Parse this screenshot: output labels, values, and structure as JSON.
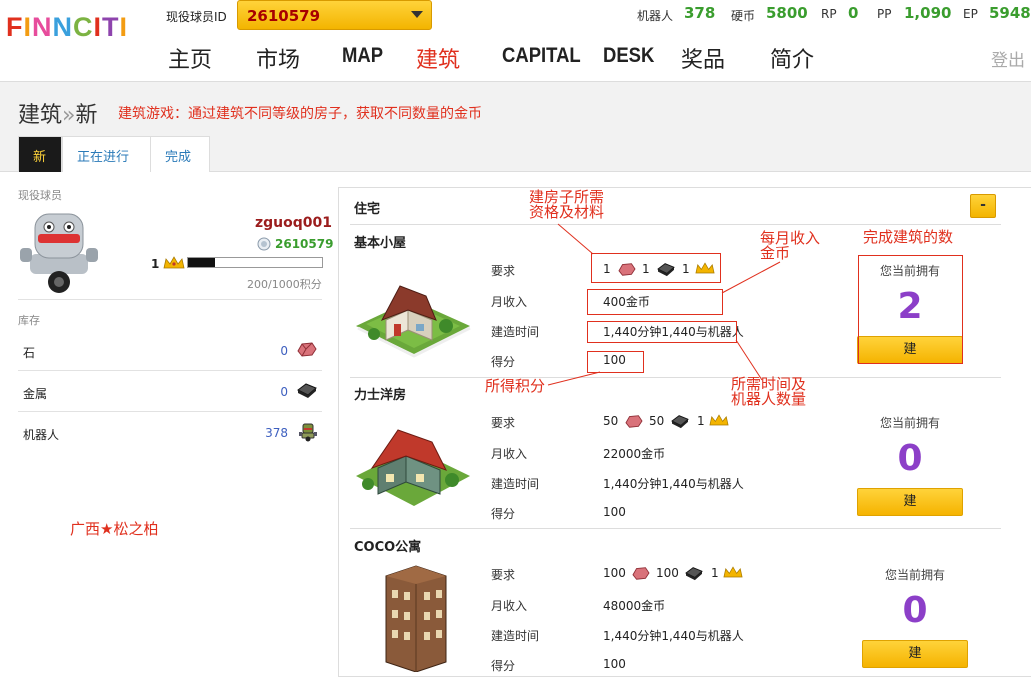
{
  "header": {
    "logo": "FINNCITI",
    "player_id_label": "现役球员ID",
    "player_id": "2610579",
    "stats": [
      {
        "label": "机器人",
        "value": "378"
      },
      {
        "label": "硬币",
        "value": "5800"
      },
      {
        "label": "RP",
        "value": "0"
      },
      {
        "label": "PP",
        "value": "1,090"
      },
      {
        "label": "EP",
        "value": "5948"
      }
    ],
    "nav": [
      "主页",
      "市场",
      "MAP",
      "建筑",
      "CAPITAL",
      "DESK",
      "奖品",
      "简介"
    ],
    "logout": "登出"
  },
  "page": {
    "title_a": "建筑",
    "title_sep": "»",
    "title_b": "新",
    "description": "建筑游戏：通过建筑不同等级的房子，获取不同数量的金币",
    "tabs": [
      "新",
      "正在进行",
      "完成"
    ]
  },
  "player": {
    "section_label": "现役球员",
    "username": "zguoq001",
    "id": "2610579",
    "level": "1",
    "progress_fraction": 0.2,
    "progress_text": "200/1000积分"
  },
  "inventory": {
    "label": "库存",
    "items": [
      {
        "name": "石",
        "count": "0",
        "icon": "stone-icon"
      },
      {
        "name": "金属",
        "count": "0",
        "icon": "metal-icon"
      },
      {
        "name": "机器人",
        "count": "378",
        "icon": "robot-icon"
      }
    ]
  },
  "signature": "广西★松之柏",
  "residence": {
    "title": "住宅",
    "collapse": "-",
    "row_labels": {
      "req": "要求",
      "income": "月收入",
      "time": "建造时间",
      "score": "得分"
    },
    "own_label": "您当前拥有",
    "build_label": "建",
    "buildings": [
      {
        "name": "基本小屋",
        "req": [
          "1",
          "1",
          "1"
        ],
        "income": "400金币",
        "time": "1,440分钟1,440与机器人",
        "score": "100",
        "owned": "2"
      },
      {
        "name": "力士洋房",
        "req": [
          "50",
          "50",
          "1"
        ],
        "income": "22000金币",
        "time": "1,440分钟1,440与机器人",
        "score": "100",
        "owned": "0"
      },
      {
        "name": "COCO公寓",
        "req": [
          "100",
          "100",
          "1"
        ],
        "income": "48000金币",
        "time": "1,440分钟1,440与机器人",
        "score": "100",
        "owned": "0"
      }
    ]
  },
  "annotations": {
    "req": "建房子所需资格及材料",
    "income": "每月收入金币",
    "owned": "完成建筑的数",
    "score": "所得积分",
    "time": "所需时间及机器人数量"
  },
  "colors": {
    "accent": "#e0301e",
    "gold": "#f5b300",
    "green": "#3a9d2e",
    "purple": "#8c3fc8"
  }
}
